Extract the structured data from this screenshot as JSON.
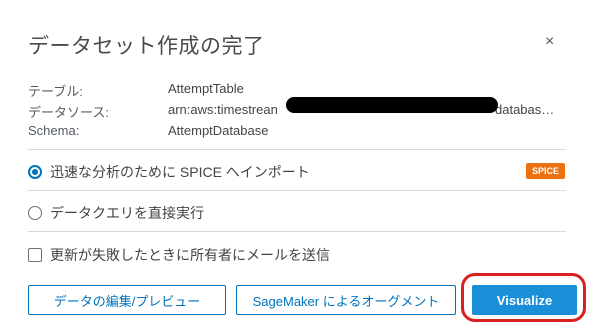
{
  "dialog": {
    "title": "データセット作成の完了",
    "close_glyph": "×"
  },
  "details": [
    {
      "label": "テーブル:",
      "value": "AttemptTable"
    },
    {
      "label": "データソース:",
      "value": "arn:aws:timestrean",
      "value_end": "databas…"
    },
    {
      "label": "Schema:",
      "value": "AttemptDatabase"
    }
  ],
  "options": {
    "spice": {
      "label": "迅速な分析のために SPICE へインポート",
      "selected": true,
      "badge": "SPICE"
    },
    "direct_query": {
      "label": "データクエリを直接実行",
      "selected": false
    },
    "email_owner": {
      "label": "更新が失敗したときに所有者にメールを送信",
      "checked": false
    }
  },
  "buttons": {
    "edit_preview": "データの編集/プレビュー",
    "sagemaker": "SageMaker によるオーグメント",
    "visualize": "Visualize"
  },
  "colors": {
    "accent": "#0073bb",
    "primary_button": "#1a8fd8",
    "badge": "#ec7211",
    "highlight": "#d91f1f"
  }
}
